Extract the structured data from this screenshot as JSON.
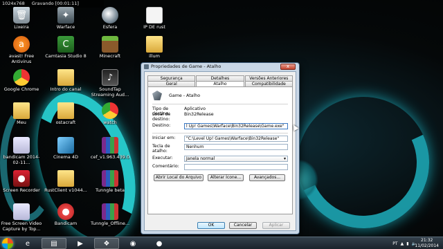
{
  "recording": {
    "resolution": "1024x768",
    "status": "Gravando [00:01:11]"
  },
  "desktop_icons": [
    {
      "label": "Lixeira",
      "icon": "recycle-bin-icon"
    },
    {
      "label": "Warface",
      "icon": "warface-icon"
    },
    {
      "label": "Esfera",
      "icon": "sphere-icon"
    },
    {
      "label": "IP DE rust",
      "icon": "text-file-icon"
    },
    {
      "label": "avast! Free Antivirus",
      "icon": "avast-icon"
    },
    {
      "label": "Camtasia Studio 8",
      "icon": "camtasia-icon"
    },
    {
      "label": "Minecraft",
      "icon": "minecraft-icon"
    },
    {
      "label": "illum",
      "icon": "folder-icon"
    },
    {
      "label": "Google Chrome",
      "icon": "chrome-icon"
    },
    {
      "label": "Intro do canal",
      "icon": "folder-icon"
    },
    {
      "label": "SoundTap Streaming Aud...",
      "icon": "soundtap-icon"
    },
    {
      "label": "Meu",
      "icon": "folder-icon"
    },
    {
      "label": "ostacraft",
      "icon": "folder-icon"
    },
    {
      "label": "watch",
      "icon": "chrome-icon"
    },
    {
      "label": "bandicam 2014-02-11...",
      "icon": "document-icon"
    },
    {
      "label": "Cinema 4D",
      "icon": "cinema4d-icon"
    },
    {
      "label": "cef_v1.963.439.0",
      "icon": "winrar-icon"
    },
    {
      "label": "Screen Recorder",
      "icon": "screen-recorder-icon"
    },
    {
      "label": "RustClient v1044...",
      "icon": "folder-icon"
    },
    {
      "label": "Tunngle beta",
      "icon": "winrar-icon"
    },
    {
      "label": "Free Screen Video Capture by Top...",
      "icon": "screen-capture-icon"
    },
    {
      "label": "Bandicam",
      "icon": "bandicam-icon"
    },
    {
      "label": "Tunngle_Offline...",
      "icon": "winrar-icon"
    }
  ],
  "dialog": {
    "title": "Propriedades de Game - Atalho",
    "close": "x",
    "tabs_row1": [
      "Segurança",
      "Detalhes",
      "Versões Anteriores"
    ],
    "tabs_row2": [
      "Geral",
      "Atalho",
      "Compatibilidade"
    ],
    "header_name": "Game - Atalho",
    "fields": {
      "tipo_destino_label": "Tipo de destino:",
      "tipo_destino_value": "Aplicativo",
      "local_destino_label": "Local de destino:",
      "local_destino_value": "Bin32Release",
      "destino_label": "Destino:",
      "destino_value": "l Up! Games\\Warface\\Bin32Release\\Game.exe\"",
      "iniciar_label": "Iniciar em:",
      "iniciar_value": "\"C:\\Level Up! Games\\Warface\\Bin32Release\"",
      "tecla_label": "Tecla de atalho:",
      "tecla_value": "Nenhum",
      "executar_label": "Executar:",
      "executar_value": "Janela normal",
      "comentario_label": "Comentário:",
      "comentario_value": ""
    },
    "buttons": {
      "abrir_local": "Abrir Local do Arquivo",
      "alterar_icone": "Alterar Ícone...",
      "avancados": "Avançados...",
      "ok": "OK",
      "cancelar": "Cancelar",
      "aplicar": "Aplicar"
    }
  },
  "taskbar": {
    "language": "PT",
    "time": "21:32",
    "date": "11/02/2014"
  }
}
